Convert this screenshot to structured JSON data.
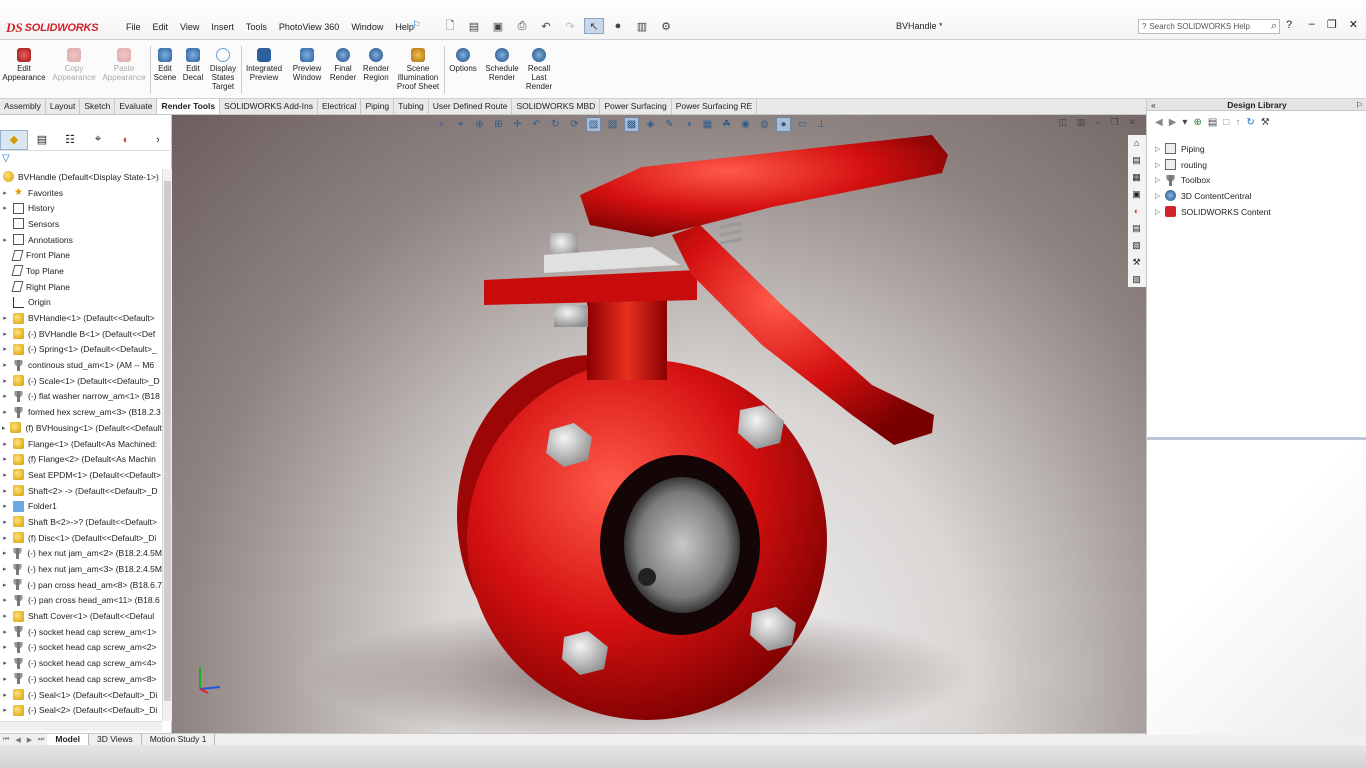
{
  "app": {
    "logo_ds": "DS",
    "logo_name": "SOLIDWORKS",
    "doc_title": "BVHandle *",
    "search_placeholder": "Search SOLIDWORKS Help",
    "help_symbol": "?"
  },
  "menu": [
    "File",
    "Edit",
    "View",
    "Insert",
    "Tools",
    "PhotoView 360",
    "Window",
    "Help"
  ],
  "ribbon": [
    {
      "label": "Edit Appearance",
      "icon": "appearance-icon",
      "enabled": true,
      "color": "#d94040"
    },
    {
      "label": "Copy Appearance",
      "icon": "copy-appearance-icon",
      "enabled": false,
      "color": "#d94040"
    },
    {
      "label": "Paste Appearance",
      "icon": "paste-appearance-icon",
      "enabled": false,
      "color": "#d94040"
    },
    {
      "label": "Edit Scene",
      "icon": "scene-icon",
      "enabled": true,
      "color": "#4a7fb8"
    },
    {
      "label": "Edit Decal",
      "icon": "decal-icon",
      "enabled": true,
      "color": "#4a7fb8"
    },
    {
      "label": "Display States Target",
      "icon": "display-states-icon",
      "enabled": true,
      "color": "#6aa0d8"
    },
    {
      "label": "Integrated Preview",
      "icon": "integrated-preview-icon",
      "enabled": true,
      "color": "#2b5f9e"
    },
    {
      "label": "Preview Window",
      "icon": "preview-window-icon",
      "enabled": true,
      "color": "#2b5f9e"
    },
    {
      "label": "Final Render",
      "icon": "final-render-icon",
      "enabled": true,
      "color": "#2b5f9e"
    },
    {
      "label": "Render Region",
      "icon": "render-region-icon",
      "enabled": true,
      "color": "#2b5f9e"
    },
    {
      "label": "Scene Illumination Proof Sheet",
      "icon": "proof-sheet-icon",
      "enabled": true,
      "color": "#d8a030"
    },
    {
      "label": "Options",
      "icon": "options-icon",
      "enabled": true,
      "color": "#2b5f9e"
    },
    {
      "label": "Schedule Render",
      "icon": "schedule-render-icon",
      "enabled": true,
      "color": "#2b5f9e"
    },
    {
      "label": "Recall Last Render",
      "icon": "recall-render-icon",
      "enabled": true,
      "color": "#2b5f9e"
    }
  ],
  "tabs": [
    "Assembly",
    "Layout",
    "Sketch",
    "Evaluate",
    "Render Tools",
    "SOLIDWORKS Add-Ins",
    "Electrical",
    "Piping",
    "Tubing",
    "User Defined Route",
    "SOLIDWORKS MBD",
    "Power Surfacing",
    "Power Surfacing RE"
  ],
  "active_tab": "Render Tools",
  "feature_tree": {
    "root": "BVHandle  (Default<Display State-1>)",
    "items": [
      {
        "label": "Favorites",
        "icon": "fav",
        "expand": true
      },
      {
        "label": "History",
        "icon": "hist",
        "expand": true
      },
      {
        "label": "Sensors",
        "icon": "sens",
        "expand": false
      },
      {
        "label": "Annotations",
        "icon": "ann",
        "expand": true
      },
      {
        "label": "Front Plane",
        "icon": "plane",
        "expand": false
      },
      {
        "label": "Top Plane",
        "icon": "plane",
        "expand": false
      },
      {
        "label": "Right Plane",
        "icon": "plane",
        "expand": false
      },
      {
        "label": "Origin",
        "icon": "origin",
        "expand": false
      },
      {
        "label": "BVHandle<1> (Default<<Default>",
        "icon": "part",
        "expand": true
      },
      {
        "label": "(-) BVHandle B<1> (Default<<Def",
        "icon": "part",
        "expand": true
      },
      {
        "label": "(-) Spring<1> (Default<<Default>_",
        "icon": "part",
        "expand": true
      },
      {
        "label": "continous stud_am<1> (AM -- M6",
        "icon": "screw",
        "expand": true
      },
      {
        "label": "(-) Scale<1> (Default<<Default>_D",
        "icon": "part",
        "expand": true
      },
      {
        "label": "(-) flat washer narrow_am<1> (B18",
        "icon": "screw",
        "expand": true
      },
      {
        "label": "formed hex screw_am<3> (B18.2.3",
        "icon": "screw",
        "expand": true
      },
      {
        "label": "(f) BVHousing<1> (Default<<Default",
        "icon": "part",
        "expand": true
      },
      {
        "label": "Flange<1> (Default<As Machined:",
        "icon": "part",
        "expand": true
      },
      {
        "label": "(f) Flange<2> (Default<As Machin",
        "icon": "part",
        "expand": true
      },
      {
        "label": "Seat EPDM<1> (Default<<Default>",
        "icon": "part",
        "expand": true
      },
      {
        "label": "Shaft<2> -> (Default<<Default>_D",
        "icon": "part",
        "expand": true
      },
      {
        "label": "Folder1",
        "icon": "folder",
        "expand": true
      },
      {
        "label": "Shaft B<2>->? (Default<<Default>",
        "icon": "part",
        "expand": true
      },
      {
        "label": "(f) Disc<1> (Default<<Default>_Di",
        "icon": "part",
        "expand": true
      },
      {
        "label": "(-) hex nut jam_am<2> (B18.2.4.5M",
        "icon": "screw",
        "expand": true
      },
      {
        "label": "(-) hex nut jam_am<3> (B18.2.4.5M",
        "icon": "screw",
        "expand": true
      },
      {
        "label": "(-) pan cross head_am<8> (B18.6.7",
        "icon": "screw",
        "expand": true
      },
      {
        "label": "(-) pan cross head_am<11> (B18.6",
        "icon": "screw",
        "expand": true
      },
      {
        "label": "Shaft  Cover<1> (Default<<Defaul",
        "icon": "part",
        "expand": true
      },
      {
        "label": "(-) socket head cap screw_am<1>",
        "icon": "screw",
        "expand": true
      },
      {
        "label": "(-) socket head cap screw_am<2>",
        "icon": "screw",
        "expand": true
      },
      {
        "label": "(-) socket head cap screw_am<4>",
        "icon": "screw",
        "expand": true
      },
      {
        "label": "(-) socket head cap screw_am<8>",
        "icon": "screw",
        "expand": true
      },
      {
        "label": "(-) Seal<1> (Default<<Default>_Di",
        "icon": "part",
        "expand": true
      },
      {
        "label": "(-) Seal<2> (Default<<Default>_Di",
        "icon": "part",
        "expand": true
      }
    ]
  },
  "design_library": {
    "title": "Design Library",
    "items": [
      {
        "label": "Piping",
        "icon": "piping-icon"
      },
      {
        "label": "routing",
        "icon": "routing-icon"
      },
      {
        "label": "Toolbox",
        "icon": "toolbox-icon"
      },
      {
        "label": "3D ContentCentral",
        "icon": "content-central-icon"
      },
      {
        "label": "SOLIDWORKS Content",
        "icon": "solidworks-content-icon"
      }
    ]
  },
  "bottom_tabs": [
    "Model",
    "3D Views",
    "Motion Study 1"
  ],
  "active_bottom_tab": "Model",
  "colors": {
    "valve_red": "#d41010",
    "accent_blue": "#1c6cc9",
    "brand_red": "#d2232a"
  }
}
